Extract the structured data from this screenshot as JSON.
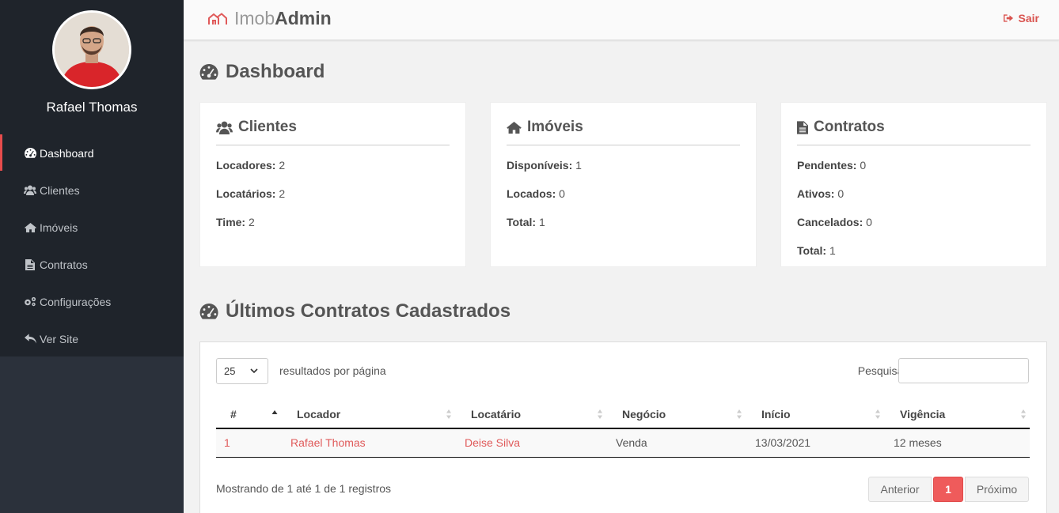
{
  "sidebar": {
    "user_name": "Rafael Thomas",
    "items": [
      {
        "label": "Dashboard",
        "icon": "dashboard-icon",
        "active": true
      },
      {
        "label": "Clientes",
        "icon": "users-icon"
      },
      {
        "label": "Imóveis",
        "icon": "home-icon"
      },
      {
        "label": "Contratos",
        "icon": "file-icon"
      },
      {
        "label": "Configurações",
        "icon": "gears-icon"
      },
      {
        "label": "Ver Site",
        "icon": "reply-icon"
      }
    ]
  },
  "header": {
    "brand_light": "Imob",
    "brand_bold": "Admin",
    "logout_label": "Sair"
  },
  "page": {
    "title": "Dashboard",
    "recent_title": "Últimos Contratos Cadastrados"
  },
  "cards": {
    "clientes": {
      "title": "Clientes",
      "lines": [
        {
          "label": "Locadores:",
          "value": "2"
        },
        {
          "label": "Locatários:",
          "value": "2"
        },
        {
          "label": "Time:",
          "value": "2"
        }
      ]
    },
    "imoveis": {
      "title": "Imóveis",
      "lines": [
        {
          "label": "Disponíveis:",
          "value": "1"
        },
        {
          "label": "Locados:",
          "value": "0"
        },
        {
          "label": "Total:",
          "value": "1"
        }
      ]
    },
    "contratos": {
      "title": "Contratos",
      "lines": [
        {
          "label": "Pendentes:",
          "value": "0"
        },
        {
          "label": "Ativos:",
          "value": "0"
        },
        {
          "label": "Cancelados:",
          "value": "0"
        },
        {
          "label": "Total:",
          "value": "1"
        }
      ]
    }
  },
  "table": {
    "page_length": "25",
    "page_length_label": "resultados por página",
    "search_label": "Pesquisar",
    "search_value": "",
    "columns": [
      "#",
      "Locador",
      "Locatário",
      "Negócio",
      "Início",
      "Vigência"
    ],
    "rows": [
      {
        "id": "1",
        "locador": "Rafael Thomas",
        "locatario": "Deise Silva",
        "negocio": "Venda",
        "inicio": "13/03/2021",
        "vigencia": "12 meses"
      }
    ],
    "info": "Mostrando de 1 até 1 de 1 registros",
    "pager": {
      "prev": "Anterior",
      "current": "1",
      "next": "Próximo"
    }
  },
  "colors": {
    "accent": "#ef5b5b",
    "link": "#e05a5a",
    "sidebar_bg": "#1f242b"
  }
}
